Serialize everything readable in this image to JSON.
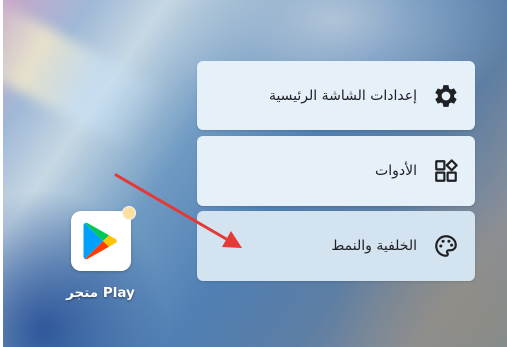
{
  "context_menu": {
    "items": [
      {
        "label": "إعدادات الشاشة الرئيسية",
        "icon": "gear-icon"
      },
      {
        "label": "الأدوات",
        "icon": "widgets-icon"
      },
      {
        "label": "الخلفية والنمط",
        "icon": "palette-icon"
      }
    ]
  },
  "app": {
    "label": "متجر Play",
    "icon": "play-store-icon"
  },
  "annotation": {
    "arrow_color": "#e53935"
  }
}
